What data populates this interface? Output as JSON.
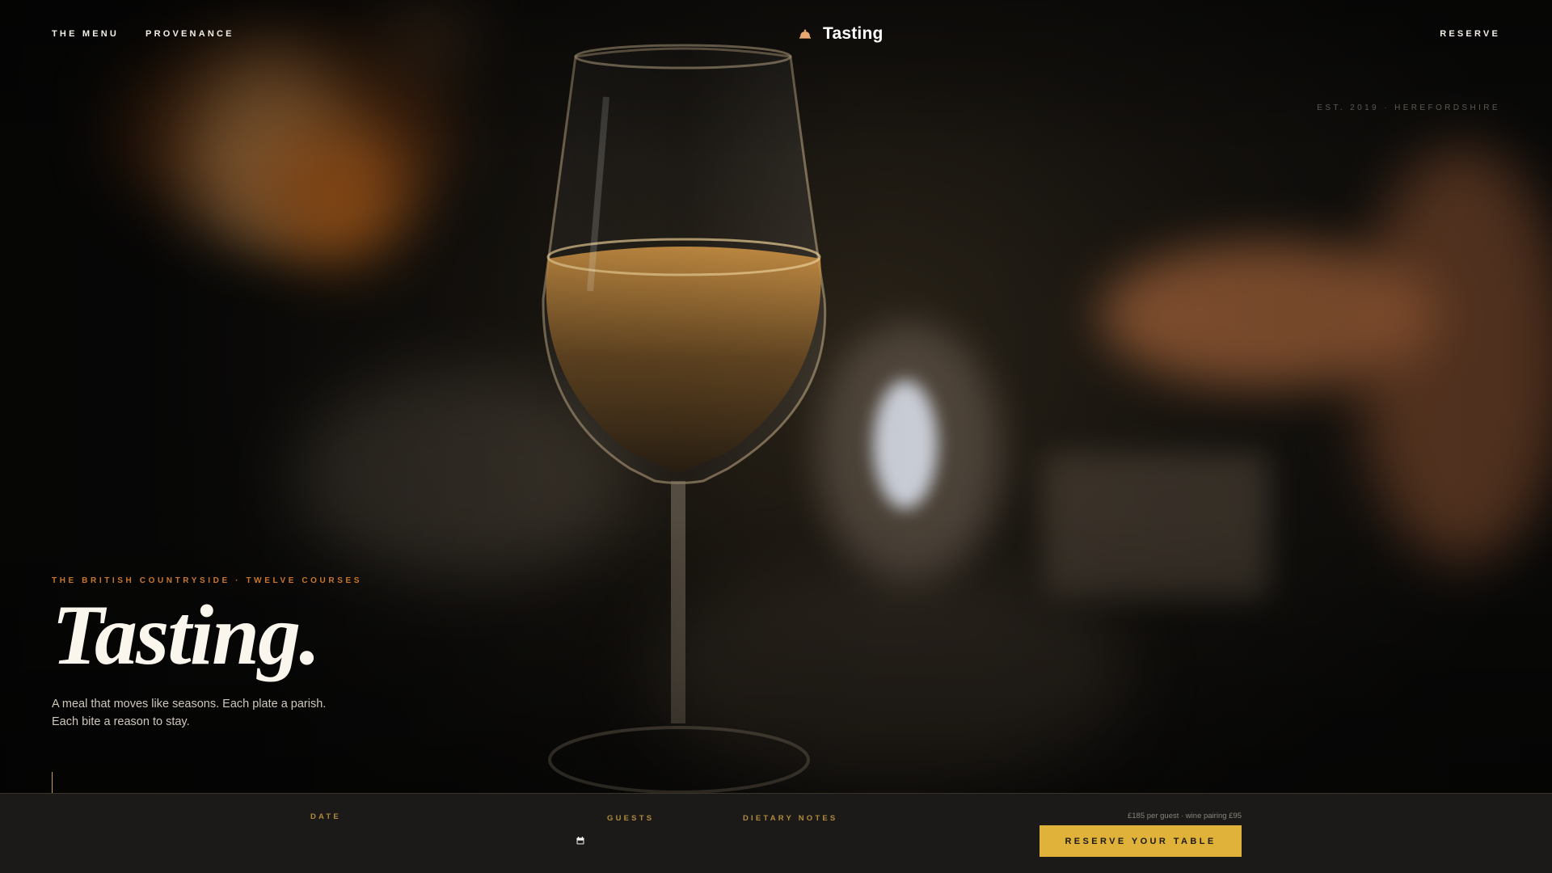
{
  "nav": {
    "left_items": [
      "THE MENU",
      "PROVENANCE"
    ],
    "brand_name": "Tasting",
    "brand_icon": "food-cloche-icon",
    "right_item": "RESERVE"
  },
  "hero": {
    "established": "EST. 2019 · HEREFORDSHIRE",
    "eyebrow": "THE BRITISH COUNTRYSIDE · TWELVE COURSES",
    "title": "Tasting.",
    "lede_line1": "A meal that moves like seasons. Each plate a parish.",
    "lede_line2": "Each bite a reason to stay."
  },
  "booking": {
    "date_label": "DATE",
    "date_value": "",
    "guests_label": "GUESTS",
    "dietary_label": "DIETARY NOTES",
    "price_note": "£185 per guest · wine pairing £95",
    "cta": "RESERVE YOUR TABLE",
    "calendar_icon": "calendar-icon"
  },
  "colors": {
    "accent_gold": "#e0b23a",
    "eyebrow_orange": "#c9772e",
    "label_gold": "#b08a3c",
    "bar_bg": "#1b1a18"
  }
}
